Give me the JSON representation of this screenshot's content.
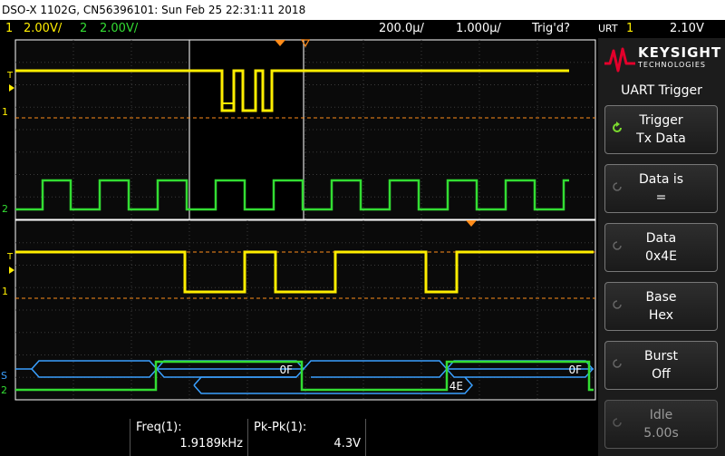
{
  "title": "DSO-X 1102G, CN56396101: Sun Feb 25 22:31:11 2018",
  "status": {
    "ch1_num": "1",
    "ch1_scale": "2.00V/",
    "ch2_num": "2",
    "ch2_scale": "2.00V/",
    "timebase": "200.0µ/",
    "delay": "1.000µ/",
    "trig_state": "Trig'd?",
    "trig_type": "URT",
    "trig_source": "1",
    "trig_level": "2.10V"
  },
  "markers": {
    "trigger_level": "T",
    "ch1": "1",
    "ch2": "2",
    "serial": "S"
  },
  "decode": {
    "upper_1": "0F",
    "upper_2": "0F",
    "lower_1": "4E"
  },
  "measurements": {
    "freq_label": "Freq(1):",
    "freq_value": "1.9189kHz",
    "pkpk_label": "Pk-Pk(1):",
    "pkpk_value": "4.3V"
  },
  "brand": {
    "name": "KEYSIGHT",
    "sub": "TECHNOLOGIES"
  },
  "menu": {
    "title": "UART Trigger",
    "keys": [
      {
        "l1": "Trigger",
        "l2": "Tx Data",
        "enabled": true
      },
      {
        "l1": "Data is",
        "l2": "=",
        "enabled": true
      },
      {
        "l1": "Data",
        "l2": "0x4E",
        "enabled": true
      },
      {
        "l1": "Base",
        "l2": "Hex",
        "enabled": true
      },
      {
        "l1": "Burst",
        "l2": "Off",
        "enabled": true
      },
      {
        "l1": "Idle",
        "l2": "5.00s",
        "enabled": false
      }
    ]
  },
  "colors": {
    "ch1": "#ffee00",
    "ch2": "#33dd33",
    "serial_bus": "#3aa0ff",
    "trigger_marker": "#ff8c1a",
    "grid": "#3a3a3a",
    "screen_bg": "#0a0a0a"
  }
}
